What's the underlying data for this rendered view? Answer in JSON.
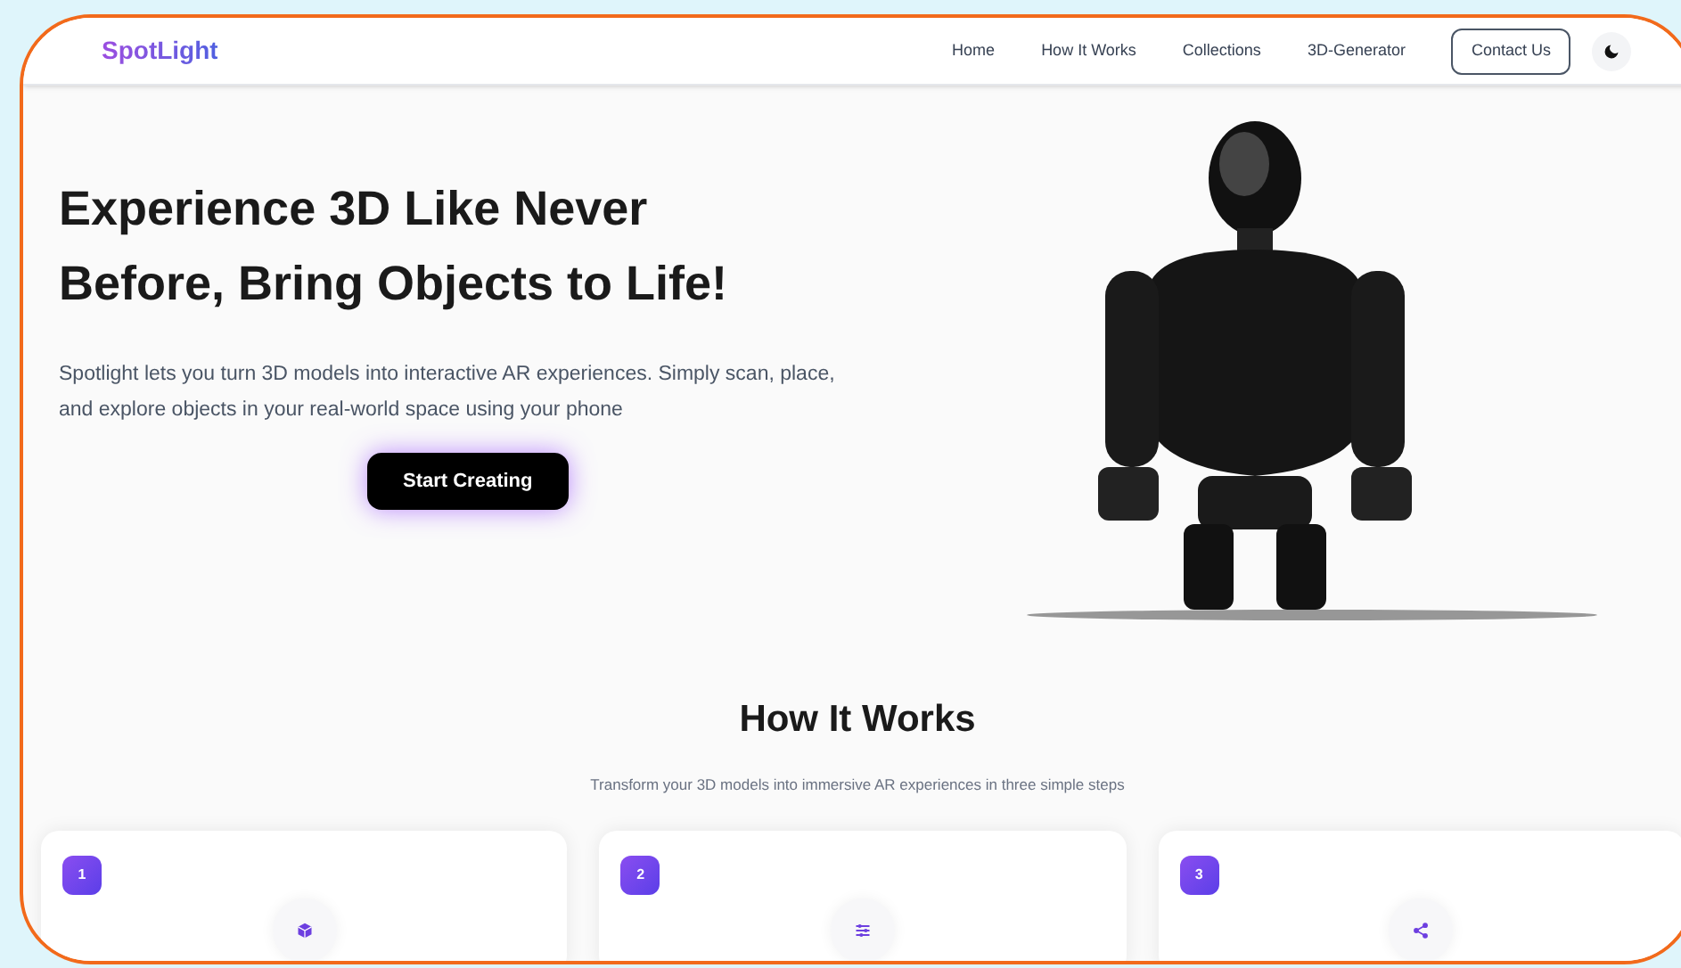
{
  "nav": {
    "logo": "SpotLight",
    "links": [
      {
        "label": "Home"
      },
      {
        "label": "How It Works"
      },
      {
        "label": "Collections"
      },
      {
        "label": "3D-Generator"
      }
    ],
    "contact_button": "Contact Us"
  },
  "hero": {
    "title": "Experience 3D Like Never Before, Bring Objects to Life!",
    "description": "Spotlight lets you turn 3D models into interactive AR experiences. Simply scan, place, and explore objects in your real-world space using your phone",
    "button": "Start Creating"
  },
  "how_it_works": {
    "title": "How It Works",
    "subtitle": "Transform your 3D models into immersive AR experiences in three simple steps"
  },
  "steps": [
    {
      "number": "1",
      "kind": "cube"
    },
    {
      "number": "2",
      "kind": "sliders"
    },
    {
      "number": "3",
      "kind": "share"
    }
  ]
}
